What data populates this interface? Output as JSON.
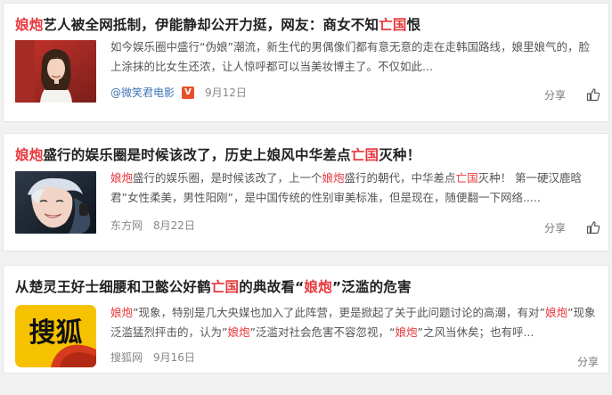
{
  "articles": [
    {
      "title_parts": [
        "娘炮",
        "艺人被全网抵制，伊能静却公开力挺，网友：商女不知",
        "亡国",
        "恨"
      ],
      "summary_parts": [
        "如今娱乐圈中盛行“伪娘”潮流，新生代的男偶像们都有意无意的走在走韩国路线，娘里娘气的，脸上涂抹的比女生还浓，让人惊呼都可以当美妆博主了。不仅如此..."
      ],
      "source": "@微笑君电影",
      "verified_badge": "V",
      "date": "9月12日",
      "share_label": "分享",
      "thumb_icon": "woman-portrait-photo"
    },
    {
      "title_parts": [
        "娘炮",
        "盛行的娱乐圈是时候该改了，历史上娘风中华差点",
        "亡国",
        "灭种！"
      ],
      "summary_parts": [
        "娘炮",
        "盛行的娱乐圈，是时候该改了，上一个",
        "娘炮",
        "盛行的朝代，中华差点",
        "亡国",
        "灭种！ 第一硬汉鹿晗君”女性柔美，男性阳刚”，是中国传统的性别审美标准，但是现在，随便翻一下网络....."
      ],
      "source": "东方网",
      "date": "8月22日",
      "share_label": "分享",
      "thumb_icon": "blond-singer-photo"
    },
    {
      "title_parts": [
        "从楚灵王好士细腰和卫懿公好鹤",
        "亡国",
        "的典故看“",
        "娘炮",
        "”泛滥的危害"
      ],
      "summary_parts": [
        "娘炮",
        "”现象，特别是几大央媒也加入了此阵营，更是掀起了关于此问题讨论的高潮，有对”",
        "娘炮",
        "”现象泛滥猛烈抨击的，认为”",
        "娘炮",
        "”泛滥对社会危害不容忽视，“",
        "娘炮",
        "”之风当休矣；也有呼..."
      ],
      "source": "搜狐网",
      "date": "9月16日",
      "share_label": "分享",
      "thumb_text": "搜狐",
      "thumb_icon": "sohu-logo"
    }
  ],
  "colors": {
    "highlight": "#e8383d",
    "link": "#3d74b4",
    "sohu_yellow": "#f6c200"
  }
}
